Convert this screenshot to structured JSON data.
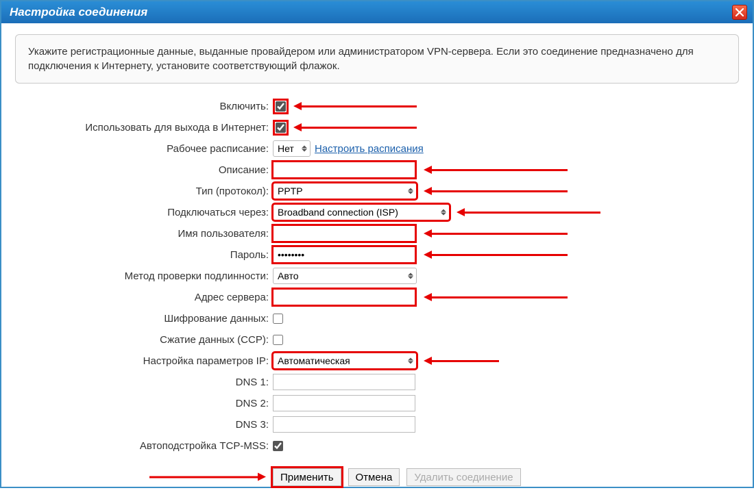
{
  "window": {
    "title": "Настройка соединения"
  },
  "info": {
    "text": "Укажите регистрационные данные, выданные провайдером или администратором VPN-сервера. Если это соединение предназначено для подключения к Интернету, установите соответствующий флажок."
  },
  "labels": {
    "enable": "Включить:",
    "use_internet": "Использовать для выхода в Интернет:",
    "schedule": "Рабочее расписание:",
    "schedule_link": "Настроить расписания",
    "description": "Описание:",
    "type": "Тип (протокол):",
    "connect_via": "Подключаться через:",
    "username": "Имя пользователя:",
    "password": "Пароль:",
    "auth": "Метод проверки подлинности:",
    "server": "Адрес сервера:",
    "encrypt": "Шифрование данных:",
    "ccp": "Сжатие данных (CCP):",
    "ip": "Настройка параметров IP:",
    "dns1": "DNS 1:",
    "dns2": "DNS 2:",
    "dns3": "DNS 3:",
    "tcpmss": "Автоподстройка TCP-MSS:"
  },
  "values": {
    "enable": true,
    "use_internet": true,
    "schedule": "Нет",
    "description": "",
    "type": "PPTP",
    "connect_via": "Broadband connection (ISP)",
    "username": "",
    "password": "••••••••",
    "auth": "Авто",
    "server": "",
    "encrypt": false,
    "ccp": false,
    "ip": "Автоматическая",
    "dns1": "",
    "dns2": "",
    "dns3": "",
    "tcpmss": true
  },
  "buttons": {
    "apply": "Применить",
    "cancel": "Отмена",
    "delete": "Удалить соединение"
  }
}
